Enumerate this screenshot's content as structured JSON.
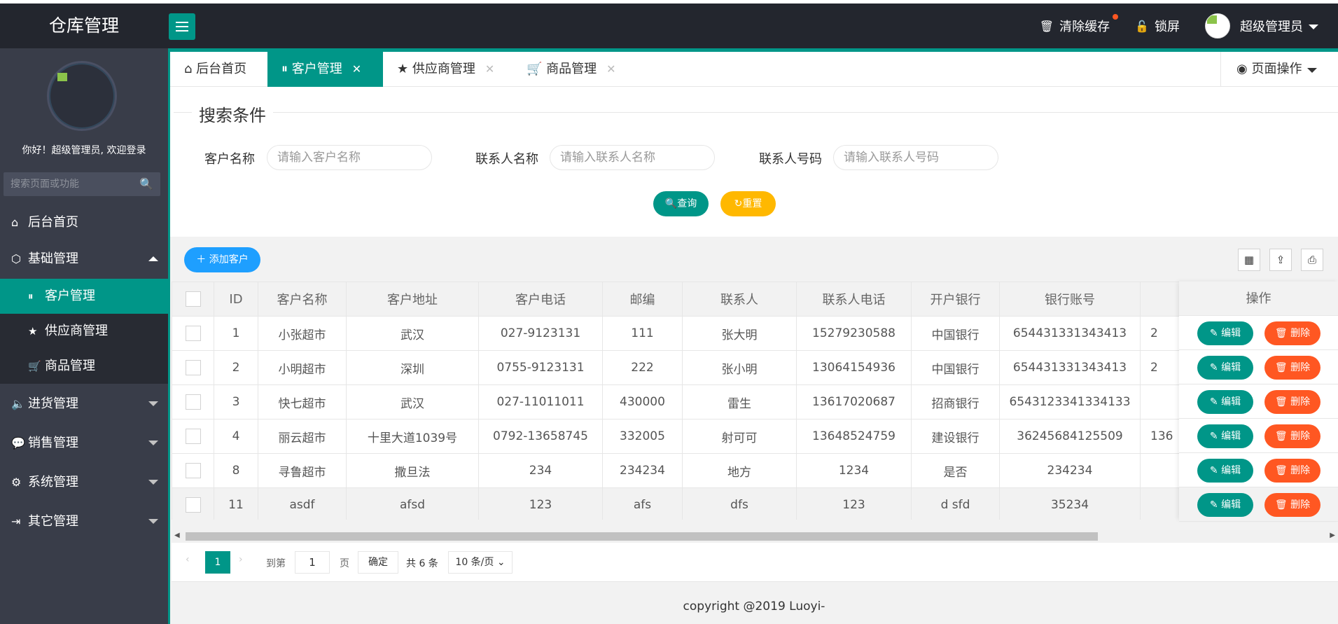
{
  "header": {
    "logo": "仓库管理",
    "clear_cache": "清除缓存",
    "lock_screen": "锁屏",
    "user": "超级管理员"
  },
  "sidebar": {
    "welcome": "你好！超级管理员, 欢迎登录",
    "search_placeholder": "搜索页面或功能",
    "items": [
      {
        "label": "后台首页",
        "icon": "home-icon"
      },
      {
        "label": "基础管理",
        "icon": "cube-icon"
      },
      {
        "label": "进货管理",
        "icon": "volume-icon"
      },
      {
        "label": "销售管理",
        "icon": "chat-icon"
      },
      {
        "label": "系统管理",
        "icon": "gear-icon"
      },
      {
        "label": "其它管理",
        "icon": "login-icon"
      }
    ],
    "subitems": [
      {
        "label": "客户管理",
        "icon": "pause-circle-icon"
      },
      {
        "label": "供应商管理",
        "icon": "star-icon"
      },
      {
        "label": "商品管理",
        "icon": "cart-icon"
      }
    ]
  },
  "tabs": [
    {
      "label": "后台首页"
    },
    {
      "label": "客户管理"
    },
    {
      "label": "供应商管理"
    },
    {
      "label": "商品管理"
    }
  ],
  "page_op": "页面操作",
  "search": {
    "legend": "搜索条件",
    "customer_label": "客户名称",
    "customer_placeholder": "请输入客户名称",
    "contact_label": "联系人名称",
    "contact_placeholder": "请输入联系人名称",
    "phone_label": "联系人号码",
    "phone_placeholder": "请输入联系人号码",
    "query": "查询",
    "reset": "重置"
  },
  "add_customer": "添加客户",
  "table": {
    "headers": [
      "ID",
      "客户名称",
      "客户地址",
      "客户电话",
      "邮编",
      "联系人",
      "联系人电话",
      "开户银行",
      "银行账号"
    ],
    "op_header": "操作",
    "edit": "编辑",
    "del": "删除",
    "rows": [
      [
        "1",
        "小张超市",
        "武汉",
        "027-9123131",
        "111",
        "张大明",
        "15279230588",
        "中国银行",
        "654431331343413",
        "2"
      ],
      [
        "2",
        "小明超市",
        "深圳",
        "0755-9123131",
        "222",
        "张小明",
        "13064154936",
        "中国银行",
        "654431331343413",
        "2"
      ],
      [
        "3",
        "快七超市",
        "武汉",
        "027-11011011",
        "430000",
        "雷生",
        "13617020687",
        "招商银行",
        "6543123341334133",
        ""
      ],
      [
        "4",
        "丽云超市",
        "十里大道1039号",
        "0792-13658745",
        "332005",
        "射可可",
        "13648524759",
        "建设银行",
        "36245684125509",
        "136"
      ],
      [
        "8",
        "寻鲁超市",
        "撒旦法",
        "234",
        "234234",
        "地方",
        "1234",
        "是否",
        "234234",
        ""
      ],
      [
        "11",
        "asdf",
        "afsd",
        "123",
        "afs",
        "dfs",
        "123",
        "d sfd",
        "35234",
        ""
      ]
    ]
  },
  "pager": {
    "current": "1",
    "goto": "到第",
    "page_input": "1",
    "page_unit": "页",
    "confirm": "确定",
    "total": "共 6 条",
    "per_page": "10 条/页"
  },
  "copyright": "copyright @2019 Luoyi-"
}
